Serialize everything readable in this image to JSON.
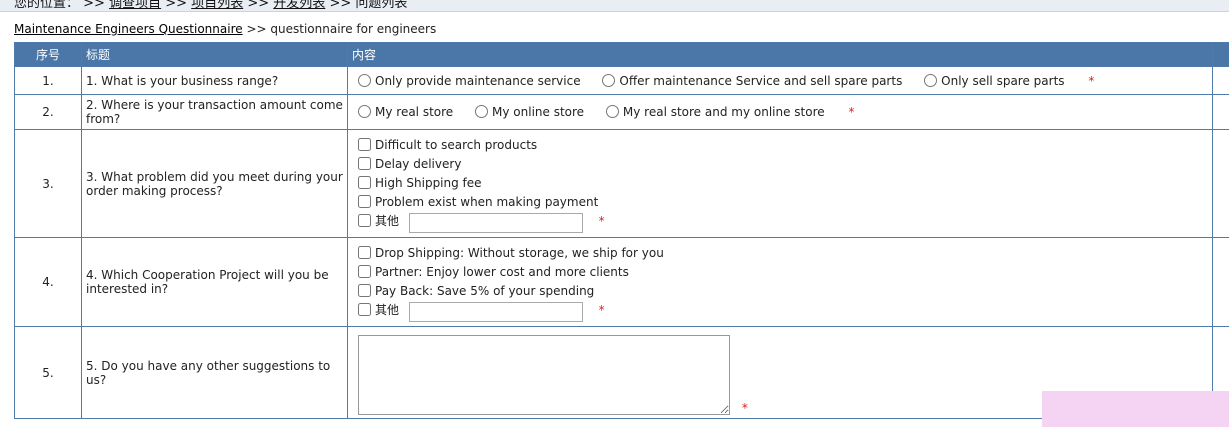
{
  "nav": {
    "label": "您的位置：",
    "sep": ">>",
    "links": [
      "调查项目",
      "项目列表",
      "开发列表"
    ],
    "current": "问题列表"
  },
  "breadcrumb": {
    "link": "Maintenance Engineers Questionnaire",
    "sep": ">>",
    "current": "questionnaire for engineers"
  },
  "table": {
    "headers": {
      "no": "序号",
      "title": "标题",
      "content": "内容"
    },
    "rows": [
      {
        "no": "1.",
        "title": "1. What is your business range?",
        "type": "radio",
        "options": [
          "Only provide maintenance service",
          "Offer maintenance Service and sell spare parts",
          "Only sell spare parts"
        ],
        "required": "*"
      },
      {
        "no": "2.",
        "title": "2. Where is your transaction amount come from?",
        "type": "radio",
        "options": [
          "My real store",
          "My online store",
          "My real store and my online store"
        ],
        "required": "*"
      },
      {
        "no": "3.",
        "title": "3. What problem did you meet during your order making process?",
        "type": "checkbox",
        "options": [
          "Difficult to search products",
          "Delay delivery",
          "High Shipping fee",
          "Problem exist when making payment"
        ],
        "other_label": "其他",
        "other_value": "",
        "required": "*"
      },
      {
        "no": "4.",
        "title": "4. Which Cooperation Project will you be interested in?",
        "type": "checkbox",
        "options": [
          "Drop Shipping: Without storage, we ship for you",
          "Partner: Enjoy lower cost and more clients",
          "Pay Back: Save 5% of your spending"
        ],
        "other_label": "其他",
        "other_value": "",
        "required": "*"
      },
      {
        "no": "5.",
        "title": "5. Do you have any other suggestions to us?",
        "type": "textarea",
        "value": "",
        "required": "*"
      }
    ]
  },
  "colors": {
    "header_bg": "#4a76a8",
    "border": "#4f7bab",
    "required": "#e02020",
    "overlay": "#f4d4f2"
  }
}
